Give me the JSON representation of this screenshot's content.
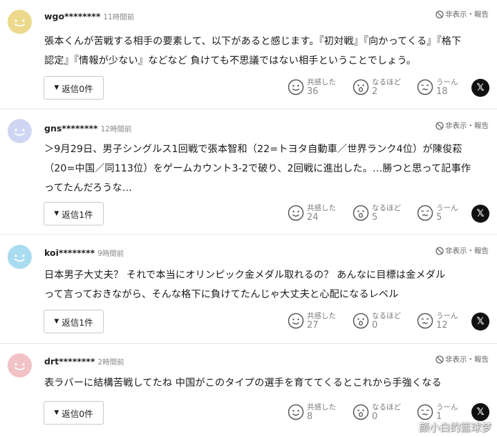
{
  "ui": {
    "hide_report": "非表示・報告",
    "reaction_labels": [
      "共感した",
      "なるほど",
      "うーん"
    ],
    "x_label": "𝕏"
  },
  "comments": [
    {
      "user": "wgo********",
      "time": "11時間前",
      "avatar_color": "#ecd98b",
      "lines": [
        "張本くんが苦戦する相手の要素して、以下があると感じます。『初対戦』『向かってくる』『格下",
        "認定』『情報が少ない』などなど 負けても不思議ではない相手ということでしょう。"
      ],
      "reply": "返信0件",
      "counts": [
        "36",
        "2",
        "18"
      ]
    },
    {
      "user": "gns********",
      "time": "12時間前",
      "avatar_color": "#cfd6f3",
      "lines": [
        "＞9月29日、男子シングルス1回戦で張本智和（22=トヨタ自動車／世界ランク4位）が陳俊菘",
        "（20=中国／同113位）をゲームカウント3-2で破り、2回戦に進出した。…勝つと思って記事作",
        "ってたんだろうな…"
      ],
      "reply": "返信1件",
      "counts": [
        "24",
        "5",
        "5"
      ]
    },
    {
      "user": "koi********",
      "time": "9時間前",
      "avatar_color": "#a9dcf0",
      "lines": [
        "日本男子大丈夫？ それで本当にオリンピック金メダル取れるの？ あんなに目標は金メダル",
        "って言っておきながら、そんな格下に負けてたんじゃ大丈夫と心配になるレベル"
      ],
      "reply": "返信1件",
      "counts": [
        "27",
        "0",
        "12"
      ]
    },
    {
      "user": "drt********",
      "time": "2時間前",
      "avatar_color": "#f1c2c6",
      "lines": [
        "表ラバーに結構苦戦してたね 中国がこのタイプの選手を育ててくるとこれから手強くなる"
      ],
      "reply": "返信0件",
      "counts": [
        "8",
        "0",
        "1"
      ]
    }
  ],
  "watermark": "颜小白的篮球梦"
}
